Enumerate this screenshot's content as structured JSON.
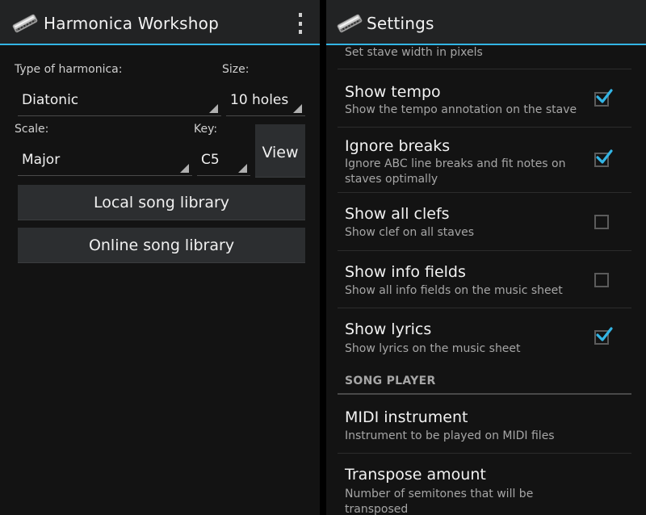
{
  "colors": {
    "accent": "#33b5e5",
    "background": "#131313",
    "actionbar": "#222324",
    "button": "#2c2e30"
  },
  "left": {
    "actionbar": {
      "title": "Harmonica Workshop",
      "app_icon": "harmonica-icon",
      "overflow_icon": "overflow-menu-icon"
    },
    "type_label": "Type of harmonica:",
    "type_value": "Diatonic",
    "size_label": "Size:",
    "size_value": "10 holes",
    "scale_label": "Scale:",
    "scale_value": "Major",
    "key_label": "Key:",
    "key_value": "C5",
    "view_button": "View",
    "local_library_button": "Local song library",
    "online_library_button": "Online song library"
  },
  "right": {
    "actionbar": {
      "title": "Settings",
      "app_icon": "harmonica-icon"
    },
    "partial_row_summary": "Set stave width in pixels",
    "items": [
      {
        "title": "Show tempo",
        "summary": "Show the tempo annotation on the stave",
        "checked": true
      },
      {
        "title": "Ignore breaks",
        "summary": "Ignore ABC line breaks and fit notes on staves optimally",
        "checked": true
      },
      {
        "title": "Show all clefs",
        "summary": "Show clef on all staves",
        "checked": false
      },
      {
        "title": "Show info fields",
        "summary": "Show all info fields on the music sheet",
        "checked": false
      },
      {
        "title": "Show lyrics",
        "summary": "Show lyrics on the music sheet",
        "checked": true
      }
    ],
    "category": "SONG PLAYER",
    "player_items": [
      {
        "title": "MIDI instrument",
        "summary": "Instrument to be played on MIDI files"
      },
      {
        "title": "Transpose amount",
        "summary": "Number of semitones that will be transposed"
      }
    ]
  }
}
